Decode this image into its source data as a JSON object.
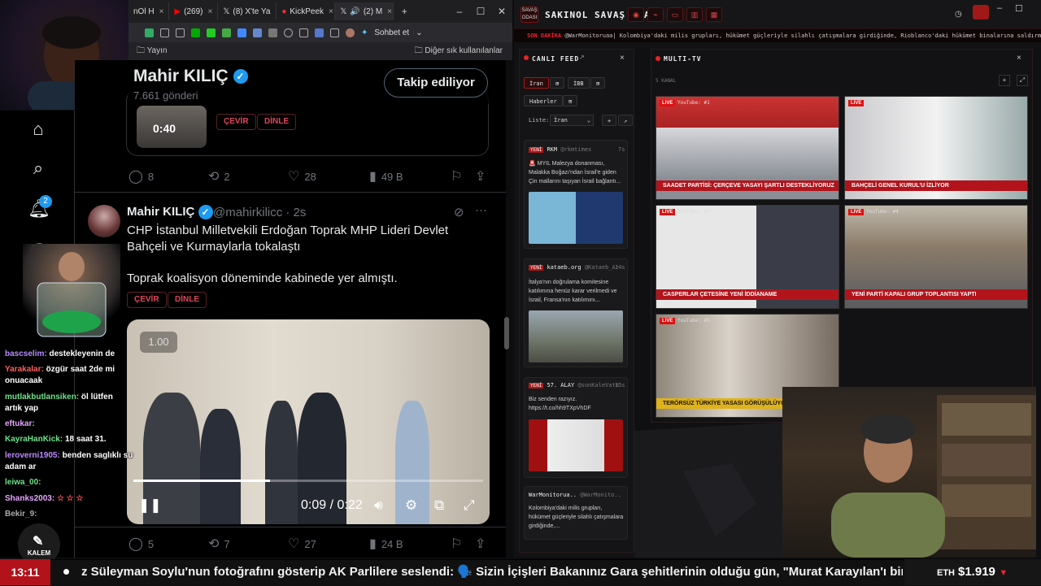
{
  "browser": {
    "tabs": [
      {
        "label": "nOl H"
      },
      {
        "label": "(269)"
      },
      {
        "label": "(8) X'te Ya"
      },
      {
        "label": "KickPeek"
      },
      {
        "label": "(2) M"
      }
    ],
    "profile_label": "Sohbet et",
    "bookmarks": {
      "left": "Yayın",
      "right": "Diğer sık kullanılanlar"
    }
  },
  "profile": {
    "name": "Mahir KILIÇ",
    "posts": "7.661 gönderi",
    "follow_label": "Takip ediliyor"
  },
  "prev_tweet": {
    "video_time": "0:40",
    "translate_label": "ÇEVİR",
    "listen_label": "DİNLE",
    "replies": "8",
    "reposts": "2",
    "likes": "28",
    "views": "49 B"
  },
  "tweet": {
    "name": "Mahir KILIÇ",
    "handle": "@mahirkilicc · 2s",
    "text": "CHP İstanbul Milletvekili Erdoğan Toprak MHP Lideri Devlet Bahçeli ve Kurmaylarla tokalaştı",
    "text2": "Toprak koalisyon döneminde kabinede yer almıştı.",
    "translate_label": "ÇEVİR",
    "listen_label": "DİNLE",
    "video_speed": "1.00",
    "video_time": "0:09 / 0:22",
    "video_progress": 0.39,
    "replies": "5",
    "reposts": "7",
    "likes": "27",
    "views": "24 B"
  },
  "x_nav": {
    "notif_count": "2"
  },
  "chat": [
    {
      "user": "bascselim:",
      "msg": "destekleyenin de",
      "color": "#b78cff"
    },
    {
      "user": "Yarakalar:",
      "msg": "özgür saat 2de mi",
      "color": "#ff5f5f"
    },
    {
      "user": "",
      "msg": "onuacaak",
      "color": "#ffffff"
    },
    {
      "user": "mutlakbutlansiken:",
      "msg": "öl lütfen",
      "color": "#6fe38a"
    },
    {
      "user": "",
      "msg": "artık yap",
      "color": "#ffffff"
    },
    {
      "user": "eftukar:",
      "msg": "",
      "color": "#e6a5ff"
    },
    {
      "user": "KayraHanKick:",
      "msg": "18 saat 31.",
      "color": "#6fe38a"
    },
    {
      "user": "leroverni1905:",
      "msg": "benden saglıklı su",
      "color": "#c08aff"
    },
    {
      "user": "",
      "msg": "adam ar",
      "color": "#ffffff"
    },
    {
      "user": "leiwa_00:",
      "msg": "",
      "color": "#6fe38a"
    },
    {
      "user": "Shanks2003:",
      "msg": "☆ ☆ ☆",
      "color": "#e6a5ff"
    },
    {
      "user": "Bekir_9:",
      "msg": "",
      "color": "#aaaaaa"
    }
  ],
  "kalem_label": "KALEM",
  "dashboard": {
    "title": "SAKINOL SAVAŞ ODASI",
    "logo": "SAVAŞ ODASI",
    "breaking_label": "SON DAKİKA",
    "breaking_text": "@WarMonitoruaa| Kolombiya'daki milis grupları, hükümet güçleriyle silahlı çatışmalara girdiğinde, Rioblanco'daki hükümet binalarına saldırmak için insansız ha",
    "feed": {
      "title": "CANLI FEED",
      "tabs": [
        "İran",
        "İBB",
        "Haberler"
      ],
      "list_label": "Liste:",
      "list_value": "İran",
      "items": [
        {
          "badge": "YENİ",
          "source": "RKM",
          "handle": "@rkmtimes",
          "age": "7s",
          "text": "🚨 MYIL Malezya donanması, Malakka Boğazı'ndan İsrail'e giden Çin mallarını taşıyan İsrail bağlantı..."
        },
        {
          "badge": "YENİ",
          "source": "kataeb.org",
          "handle": "@Kataeb_Ar",
          "age": "14s",
          "text": "İtalya'nın doğrulama komitesine katılımına henüz karar verilmedi ve İsrail, Fransa'nın katılımını..."
        },
        {
          "badge": "YENİ",
          "source": "57. ALAY",
          "handle": "@sonKaleVatn",
          "age": "15s",
          "text": "Biz senden razıyız. https://t.co/hh9TXpVhDF"
        },
        {
          "badge": "",
          "source": "WarMonitorua..",
          "handle": "@WarMonito..",
          "age": "",
          "text": "Kolombiya'daki milis grupları, hükümet güçleriyle silahlı çatışmalara girdiğinde,..."
        }
      ]
    },
    "multitv": {
      "title": "MULTI-TV",
      "count_label": "5 KANAL",
      "channels": [
        {
          "label": "YouTube: #1",
          "banner": "SAADET PARTİSİ: ÇERÇEVE YASAYI ŞARTLI DESTEKLİYORUZ"
        },
        {
          "label": "YouTube: #2",
          "banner": "BAHÇELİ GENEL KURUL'U İZLİYOR"
        },
        {
          "label": "YouTube: #3",
          "banner": "CASPERLAR ÇETESİNE YENİ İDDİANAME"
        },
        {
          "label": "YouTube: #4",
          "banner": "YENİ PARTİ KAPALI GRUP TOPLANTISI YAPTI"
        },
        {
          "label": "YouTube: #5",
          "banner": "TERÖRSÜZ TÜRKİYE YASASI GÖRÜŞÜLÜYOR"
        }
      ]
    }
  },
  "ticker": {
    "clock": "13:11",
    "text": "z Süleyman Soylu'nun fotoğrafını gösterip AK Parlilere seslendi: 🗣️ Sizin İçişleri Bakanınız Gara şehitlerinin olduğu gün, \"Murat Karayılan'ı bin parçaya bölm",
    "eth_label": "ETH",
    "eth_value": "$1.919",
    "eth_arrow": "▼"
  },
  "colors": {
    "x_blue": "#1d9bf0",
    "alert_red": "#b3121a"
  }
}
